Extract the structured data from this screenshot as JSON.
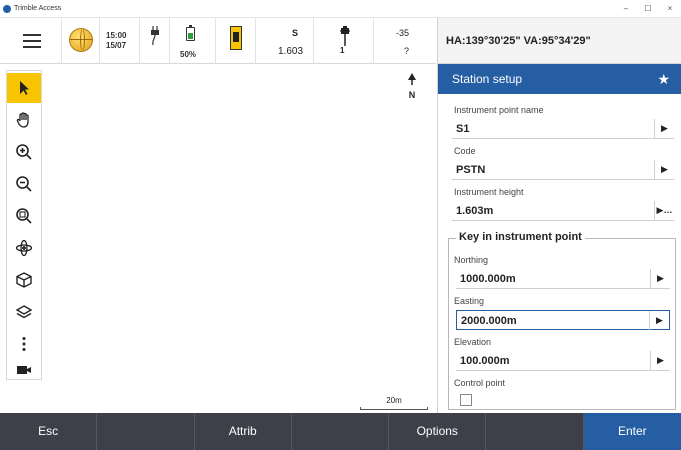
{
  "window": {
    "title": "Trimble Access",
    "minimize": "–",
    "maximize": "☐",
    "close": "×"
  },
  "status": {
    "time": "15:00",
    "date": "15/07",
    "battery": "50%",
    "battery_level": 0.5,
    "height_top": "S",
    "height_value": "1.603",
    "target_number": "1",
    "prism_top": "-35",
    "prism_bottom": "?"
  },
  "angles": "HA:139°30'25\"  VA:95°34'29\"",
  "map": {
    "north_label": "N",
    "scale_label": "20m"
  },
  "panel": {
    "title": "Station setup",
    "fields": {
      "point_name_label": "Instrument point name",
      "point_name_value": "S1",
      "code_label": "Code",
      "code_value": "PSTN",
      "height_label": "Instrument height",
      "height_value": "1.603m"
    },
    "group_title": "Key in instrument point",
    "group": {
      "northing_label": "Northing",
      "northing_value": "1000.000m",
      "easting_label": "Easting",
      "easting_value": "2000.000m",
      "elevation_label": "Elevation",
      "elevation_value": "100.000m",
      "control_label": "Control point"
    }
  },
  "bottom_bar": {
    "esc": "Esc",
    "attrib": "Attrib",
    "options": "Options",
    "enter": "Enter"
  },
  "colors": {
    "accent": "#255ea3",
    "toolbar_active": "#f6c400",
    "bottom_bar": "#3d3f49"
  }
}
